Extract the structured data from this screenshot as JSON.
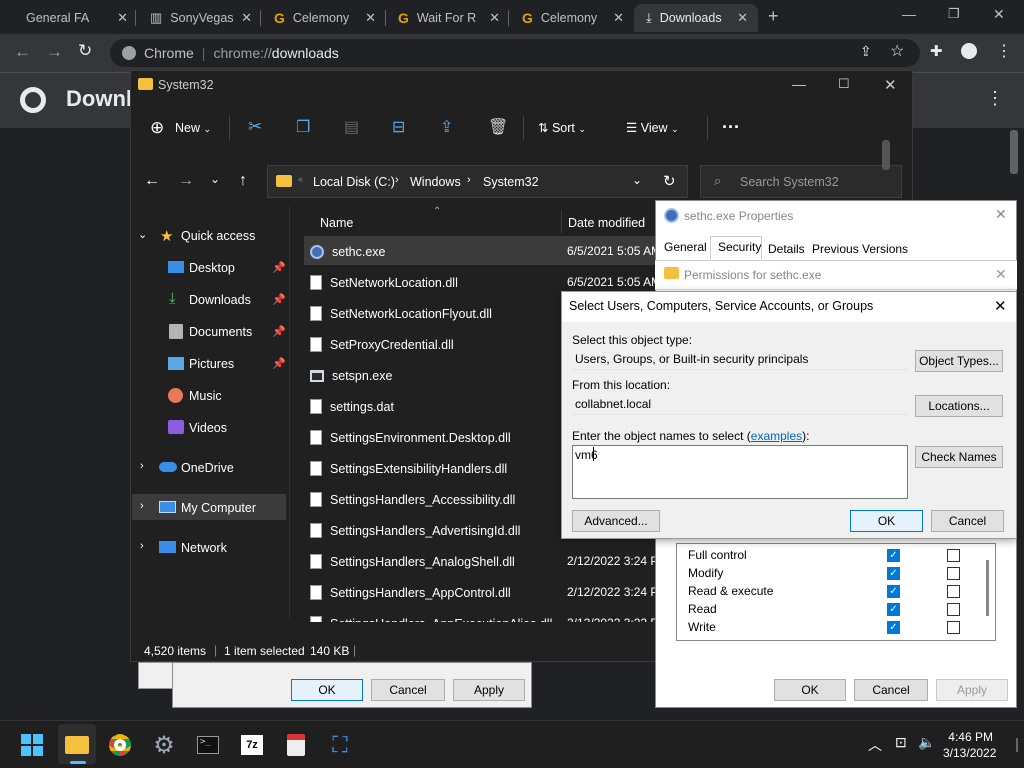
{
  "chrome": {
    "tabs": [
      {
        "title": "General FA"
      },
      {
        "title": "SonyVegas"
      },
      {
        "title": "Celemony"
      },
      {
        "title": "Wait For R"
      },
      {
        "title": "Celemony"
      },
      {
        "title": "Downloads"
      }
    ],
    "url_site": "Chrome",
    "url_scheme": "chrome://",
    "url_path": "downloads",
    "page_title": "Downl"
  },
  "explorer": {
    "title": "System32",
    "commands": {
      "new": "New",
      "sort": "Sort",
      "view": "View"
    },
    "breadcrumb": [
      "Local Disk (C:)",
      "Windows",
      "System32"
    ],
    "search_placeholder": "Search System32",
    "nav": {
      "quick_access": "Quick access",
      "pinned": [
        "Desktop",
        "Downloads",
        "Documents",
        "Pictures"
      ],
      "unpinned": [
        "Music",
        "Videos"
      ],
      "onedrive": "OneDrive",
      "mycomputer": "My Computer",
      "network": "Network"
    },
    "columns": {
      "name": "Name",
      "date": "Date modified"
    },
    "files": [
      {
        "name": "sethc.exe",
        "date": "6/5/2021 5:05 AM"
      },
      {
        "name": "SetNetworkLocation.dll",
        "date": "6/5/2021 5:05 AM"
      },
      {
        "name": "SetNetworkLocationFlyout.dll",
        "date": ""
      },
      {
        "name": "SetProxyCredential.dll",
        "date": ""
      },
      {
        "name": "setspn.exe",
        "date": ""
      },
      {
        "name": "settings.dat",
        "date": ""
      },
      {
        "name": "SettingsEnvironment.Desktop.dll",
        "date": ""
      },
      {
        "name": "SettingsExtensibilityHandlers.dll",
        "date": ""
      },
      {
        "name": "SettingsHandlers_Accessibility.dll",
        "date": ""
      },
      {
        "name": "SettingsHandlers_AdvertisingId.dll",
        "date": ""
      },
      {
        "name": "SettingsHandlers_AnalogShell.dll",
        "date": "2/12/2022 3:24 P"
      },
      {
        "name": "SettingsHandlers_AppControl.dll",
        "date": "2/12/2022 3:24 P"
      },
      {
        "name": "SettingsHandlers_AppExecutionAlias.dll",
        "date": "2/12/2022 3:22 P"
      }
    ],
    "status": {
      "items": "4,520 items",
      "selected": "1 item selected",
      "size": "140 KB"
    }
  },
  "back_dialog": {
    "ok": "OK",
    "cancel": "Cancel",
    "apply": "Apply"
  },
  "properties": {
    "title": "sethc.exe Properties",
    "tabs": [
      "General",
      "Security",
      "Details",
      "Previous Versions"
    ],
    "ok": "OK",
    "cancel": "Cancel",
    "apply": "Apply",
    "permissions": [
      {
        "name": "Full control",
        "allow": true,
        "deny": false
      },
      {
        "name": "Modify",
        "allow": true,
        "deny": false
      },
      {
        "name": "Read & execute",
        "allow": true,
        "deny": false
      },
      {
        "name": "Read",
        "allow": true,
        "deny": false
      },
      {
        "name": "Write",
        "allow": true,
        "deny": false
      }
    ]
  },
  "permissions_dialog": {
    "title": "Permissions for sethc.exe"
  },
  "select_dialog": {
    "title": "Select Users, Computers, Service Accounts, or Groups",
    "object_type_label": "Select this object type:",
    "object_type_value": "Users, Groups, or Built-in security principals",
    "object_types_button": "Object Types...",
    "location_label": "From this location:",
    "location_value": "collabnet.local",
    "locations_button": "Locations...",
    "names_label": "Enter the object names to select (",
    "examples_link": "examples",
    "names_label_end": "):",
    "names_value": "vm6",
    "check_names_button": "Check Names",
    "advanced_button": "Advanced...",
    "ok": "OK",
    "cancel": "Cancel"
  },
  "taskbar": {
    "time": "4:46 PM",
    "date": "3/13/2022"
  },
  "colors": {
    "accent": "#0078d7",
    "folder": "#f4c03e"
  }
}
